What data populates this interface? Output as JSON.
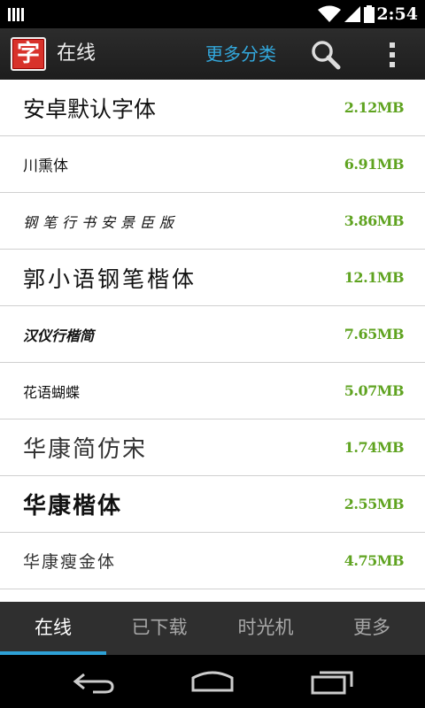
{
  "status_bar": {
    "time": "2:54"
  },
  "action_bar": {
    "app_icon_char": "字",
    "title": "在线",
    "more_categories": "更多分类"
  },
  "fonts": [
    {
      "name": "安卓默认字体",
      "size": "2.12MB"
    },
    {
      "name": "川熏体",
      "size": "6.91MB"
    },
    {
      "name": "钢笔行书安景臣版",
      "size": "3.86MB"
    },
    {
      "name": "郭小语钢笔楷体",
      "size": "12.1MB"
    },
    {
      "name": "汉仪行楷简",
      "size": "7.65MB"
    },
    {
      "name": "花语蝴蝶",
      "size": "5.07MB"
    },
    {
      "name": "华康简仿宋",
      "size": "1.74MB"
    },
    {
      "name": "华康楷体",
      "size": "2.55MB"
    },
    {
      "name": "华康瘦金体",
      "size": "4.75MB"
    }
  ],
  "tabs": [
    {
      "label": "在线",
      "active": true
    },
    {
      "label": "已下载",
      "active": false
    },
    {
      "label": "时光机",
      "active": false
    },
    {
      "label": "更多",
      "active": false
    }
  ],
  "colors": {
    "accent": "#33a9de",
    "size_green": "#5fa320",
    "icon_red": "#d8322b"
  }
}
